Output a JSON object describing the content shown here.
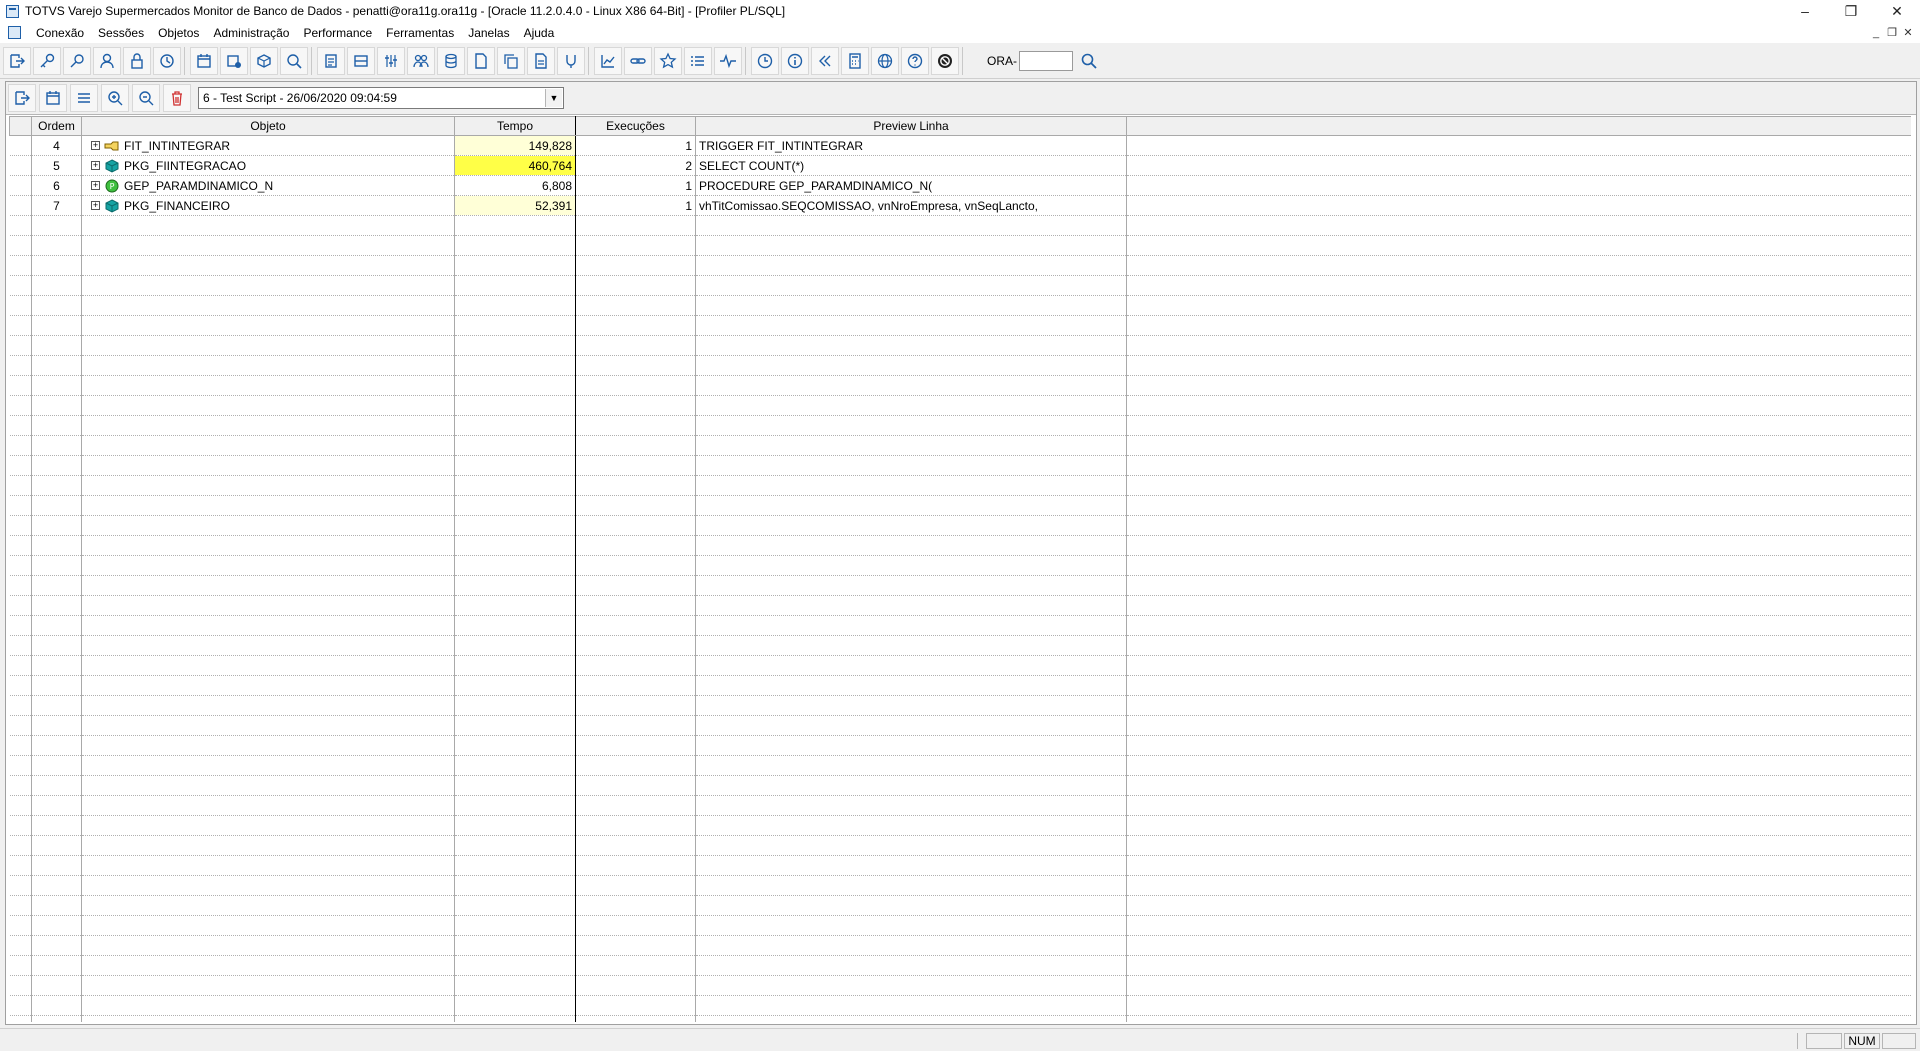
{
  "window": {
    "title": "TOTVS Varejo Supermercados Monitor de Banco de Dados - penatti@ora11g.ora11g - [Oracle 11.2.0.4.0 - Linux X86 64-Bit] - [Profiler PL/SQL]",
    "controls": {
      "minimize": "–",
      "restore": "❐",
      "close": "✕"
    }
  },
  "menu": {
    "items": [
      "Conexão",
      "Sessões",
      "Objetos",
      "Administração",
      "Performance",
      "Ferramentas",
      "Janelas",
      "Ajuda"
    ],
    "mdi": {
      "minimize": "_",
      "restore": "❐",
      "close": "✕"
    }
  },
  "toolbar": {
    "ora_label": "ORA-",
    "ora_value": ""
  },
  "profiler": {
    "run_selected": "6 - Test Script - 26/06/2020 09:04:59"
  },
  "grid": {
    "columns": [
      "Ordem",
      "Objeto",
      "Tempo",
      "Execuções",
      "Preview Linha",
      ""
    ],
    "rows": [
      {
        "ordem": "4",
        "objeto": "FIT_INTINTEGRAR",
        "icon": "trigger-icon",
        "tempo": "149,828",
        "execucoes": "1",
        "preview": "TRIGGER FIT_INTINTEGRAR",
        "highlight": "light"
      },
      {
        "ordem": "5",
        "objeto": "PKG_FIINTEGRACAO",
        "icon": "package-icon",
        "tempo": "460,764",
        "execucoes": "2",
        "preview": "SELECT  COUNT(*)",
        "highlight": "strong"
      },
      {
        "ordem": "6",
        "objeto": "GEP_PARAMDINAMICO_N",
        "icon": "procedure-icon",
        "tempo": "6,808",
        "execucoes": "1",
        "preview": "PROCEDURE GEP_PARAMDINAMICO_N(",
        "highlight": "none"
      },
      {
        "ordem": "7",
        "objeto": "PKG_FINANCEIRO",
        "icon": "package-icon",
        "tempo": "52,391",
        "execucoes": "1",
        "preview": "vhTitComissao.SEQCOMISSAO, vnNroEmpresa, vnSeqLancto,",
        "highlight": "light"
      }
    ]
  },
  "statusbar": {
    "num": "NUM"
  },
  "colors": {
    "highlight_light": "#ffffd7",
    "highlight_strong": "#ffff47",
    "icon_blue": "#1e5fa8",
    "package_teal": "#15a3a3"
  }
}
